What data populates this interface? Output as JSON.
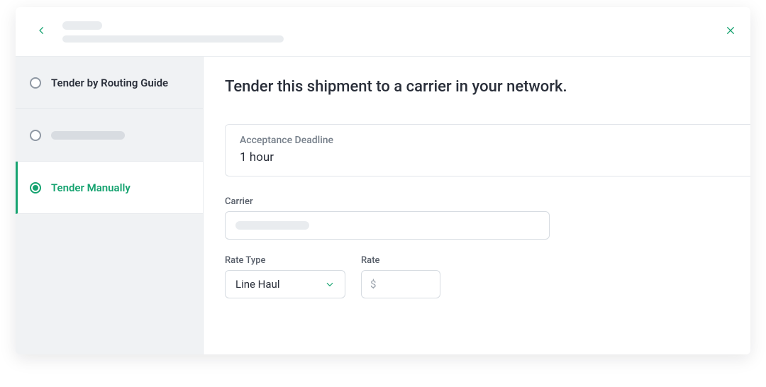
{
  "colors": {
    "accent": "#16a370"
  },
  "header": {
    "title_skeleton": true,
    "subtitle_skeleton": true
  },
  "sidebar": {
    "items": [
      {
        "key": "routing-guide",
        "label": "Tender by Routing Guide",
        "selected": false,
        "skeleton": false
      },
      {
        "key": "item-2",
        "label": "",
        "selected": false,
        "skeleton": true
      },
      {
        "key": "manual",
        "label": "Tender Manually",
        "selected": true,
        "skeleton": false
      }
    ]
  },
  "main": {
    "heading": "Tender this shipment to a carrier in your network.",
    "deadline": {
      "label": "Acceptance Deadline",
      "value": "1 hour"
    },
    "carrier": {
      "label": "Carrier",
      "value": "",
      "placeholder_skeleton": true
    },
    "rate_type": {
      "label": "Rate Type",
      "value": "Line Haul",
      "options": [
        "Line Haul"
      ]
    },
    "rate": {
      "label": "Rate",
      "currency_symbol": "$",
      "value": ""
    }
  }
}
